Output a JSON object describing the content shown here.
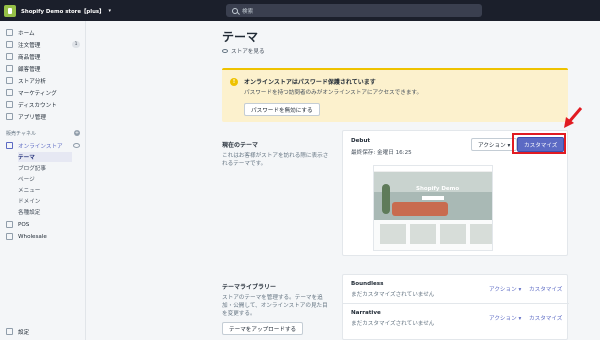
{
  "topbar": {
    "store_name": "Shopify Demo store【plus】",
    "caret": "▾",
    "search_placeholder": "検索"
  },
  "sidebar": {
    "items": [
      {
        "label": "ホーム"
      },
      {
        "label": "注文管理",
        "badge": "1"
      },
      {
        "label": "商品管理"
      },
      {
        "label": "顧客管理"
      },
      {
        "label": "ストア分析"
      },
      {
        "label": "マーケティング"
      },
      {
        "label": "ディスカウント"
      },
      {
        "label": "アプリ管理"
      }
    ],
    "channels_heading": "販売チャネル",
    "online_store": "オンラインストア",
    "sub_items": [
      {
        "label": "テーマ"
      },
      {
        "label": "ブログ記事"
      },
      {
        "label": "ページ"
      },
      {
        "label": "メニュー"
      },
      {
        "label": "ドメイン"
      },
      {
        "label": "各種設定"
      }
    ],
    "other_channels": [
      {
        "label": "POS"
      },
      {
        "label": "Wholesale"
      }
    ],
    "settings": "設定"
  },
  "main": {
    "title": "テーマ",
    "view_store": "ストアを見る",
    "banner": {
      "title": "オンラインストアはパスワード保護されています",
      "text": "パスワードを持つ訪問者のみがオンラインストアにアクセスできます。",
      "button": "パスワードを無効にする",
      "icon": "!"
    },
    "current_theme": {
      "heading": "現在のテーマ",
      "description": "これはお客様がストアを訪れる際に表示されるテーマです。",
      "name": "Debut",
      "last_saved": "最終保存: 金曜日 16:25",
      "action_button": "アクション ▾",
      "customize_button": "カスタマイズ",
      "preview_title": "Shopify Demo"
    },
    "library": {
      "heading": "テーマライブラリー",
      "description": "ストアのテーマを管理する。テーマを追加・公開して、オンラインストアの見た目を変更する。",
      "upload_button": "テーマをアップロードする",
      "themes": [
        {
          "name": "Boundless",
          "status": "まだカスタマイズされていません",
          "action": "アクション ▾",
          "customize": "カスタマイズ"
        },
        {
          "name": "Narrative",
          "status": "まだカスタマイズされていません",
          "action": "アクション ▾",
          "customize": "カスタマイズ"
        }
      ]
    }
  },
  "colors": {
    "topbar": "#1b1f2b",
    "accent": "#5c6ac4",
    "highlight": "#e11b22",
    "warning": "#eec200"
  }
}
